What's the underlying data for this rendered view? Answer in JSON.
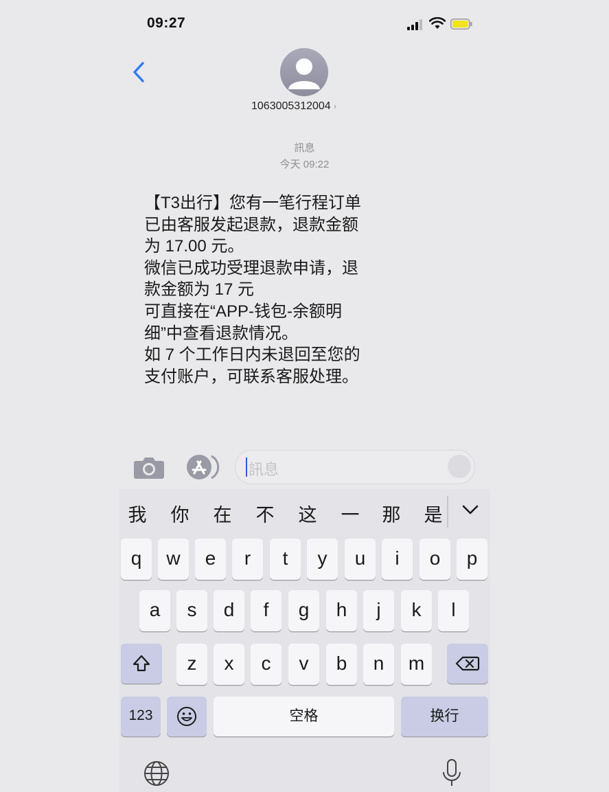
{
  "status_bar": {
    "time": "09:27"
  },
  "header": {
    "sender_number": "1063005312004",
    "chevron": "›"
  },
  "conversation": {
    "service_label": "訊息",
    "timestamp": "今天 09:22",
    "message_lines": [
      "【T3出行】您有一笔行程订单",
      "已由客服发起退款，退款金额",
      "为 17.00 元。",
      "微信已成功受理退款申请，退",
      "款金额为 17 元",
      "可直接在“APP-钱包-余额明",
      "细”中查看退款情况。",
      "如 7 个工作日内未退回至您的",
      "支付账户，可联系客服处理。"
    ]
  },
  "compose": {
    "placeholder": "訊息"
  },
  "keyboard": {
    "candidates": [
      "我",
      "你",
      "在",
      "不",
      "这",
      "一",
      "那",
      "是"
    ],
    "row1": [
      "q",
      "w",
      "e",
      "r",
      "t",
      "y",
      "u",
      "i",
      "o",
      "p"
    ],
    "row2": [
      "a",
      "s",
      "d",
      "f",
      "g",
      "h",
      "j",
      "k",
      "l"
    ],
    "row3": [
      "z",
      "x",
      "c",
      "v",
      "b",
      "n",
      "m"
    ],
    "numbers_label": "123",
    "space_label": "空格",
    "return_label": "换行"
  },
  "icons": {
    "signal": "signal-icon",
    "wifi": "wifi-icon",
    "battery": "battery-icon",
    "back": "chevron-left-icon",
    "avatar": "person-icon",
    "camera": "camera-icon",
    "appstore": "app-store-icon",
    "shift": "shift-icon",
    "delete": "delete-icon",
    "emoji": "emoji-icon",
    "globe": "globe-icon",
    "mic": "microphone-icon"
  },
  "colors": {
    "accent": "#2f7bf5",
    "battery": "#f1e41c",
    "background": "#e9e9eb"
  }
}
